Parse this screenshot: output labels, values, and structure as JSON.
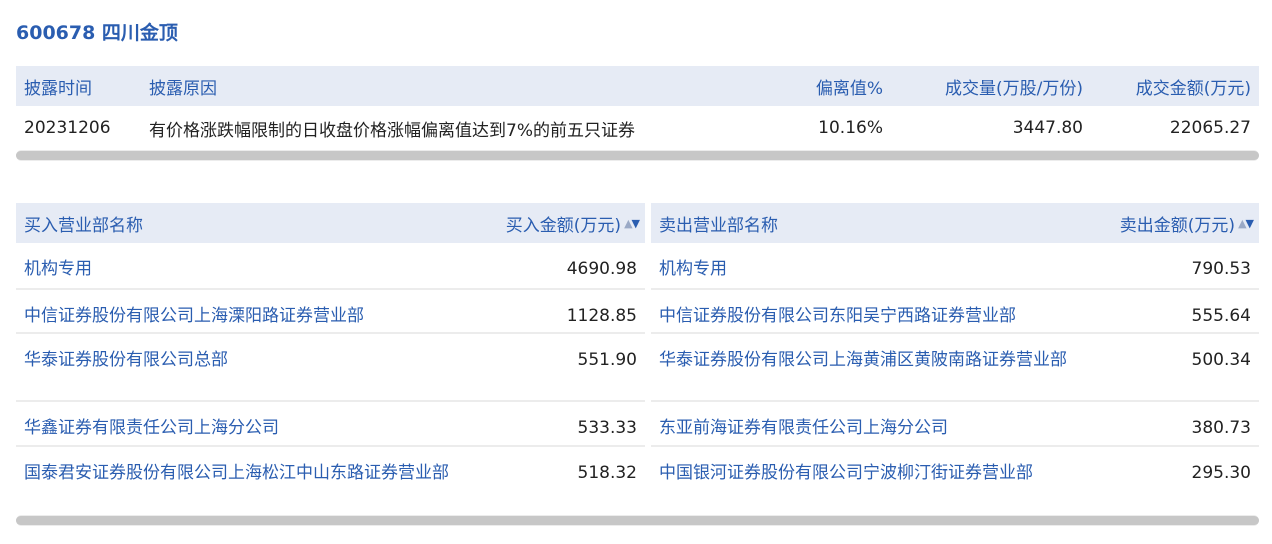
{
  "stock": {
    "title": "600678 四川金顶"
  },
  "info": {
    "headers": [
      "披露时间",
      "披露原因",
      "偏离值%",
      "成交量(万股/万份)",
      "成交金额(万元)"
    ],
    "row": [
      "20231206",
      "有价格涨跌幅限制的日收盘价格涨幅偏离值达到7%的前五只证券",
      "10.16%",
      "3447.80",
      "22065.27"
    ]
  },
  "buy": {
    "header_name": "买入营业部名称",
    "header_amount": "买入金额(万元)",
    "rows": [
      {
        "name": "机构专用",
        "amount": "4690.98"
      },
      {
        "name": "中信证券股份有限公司上海溧阳路证券营业部",
        "amount": "1128.85"
      },
      {
        "name": "华泰证券股份有限公司总部",
        "amount": "551.90"
      },
      {
        "name": "华鑫证券有限责任公司上海分公司",
        "amount": "533.33"
      },
      {
        "name": "国泰君安证券股份有限公司上海松江中山东路证券营业部",
        "amount": "518.32"
      }
    ]
  },
  "sell": {
    "header_name": "卖出营业部名称",
    "header_amount": "卖出金额(万元)",
    "rows": [
      {
        "name": "机构专用",
        "amount": "790.53"
      },
      {
        "name": "中信证券股份有限公司东阳吴宁西路证券营业部",
        "amount": "555.64"
      },
      {
        "name": "华泰证券股份有限公司上海黄浦区黄陂南路证券营业部",
        "amount": "500.34"
      },
      {
        "name": "东亚前海证券有限责任公司上海分公司",
        "amount": "380.73"
      },
      {
        "name": "中国银河证券股份有限公司宁波柳汀街证券营业部",
        "amount": "295.30"
      }
    ]
  },
  "icons": {
    "sort": "sort-up-down-icon"
  },
  "colors": {
    "accent": "#2a5db0",
    "header_bg": "#e6ebf5"
  }
}
